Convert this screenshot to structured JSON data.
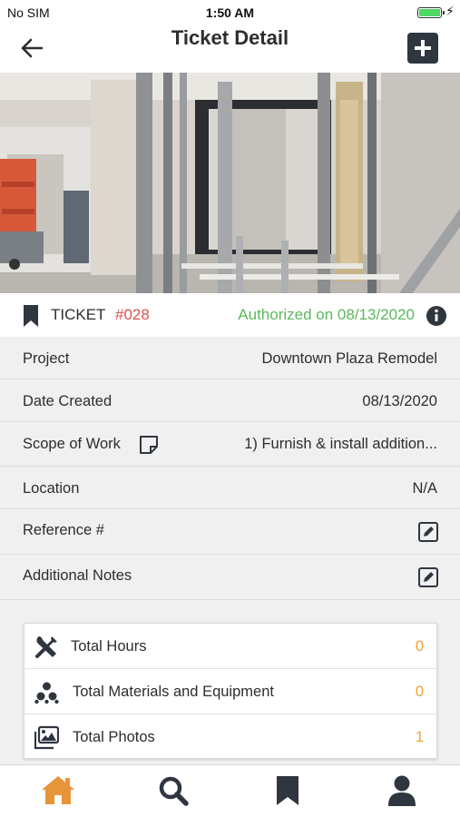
{
  "status_bar": {
    "carrier": "No SIM",
    "time": "1:50 AM"
  },
  "nav": {
    "title": "Ticket Detail",
    "back_icon": "arrow-left-icon",
    "add_icon": "plus-square-icon"
  },
  "ticket": {
    "label": "TICKET",
    "number": "#028",
    "status": "Authorized on 08/13/2020",
    "status_color": "#5cb85c",
    "number_color": "#d9534f"
  },
  "details": {
    "project_label": "Project",
    "project_value": "Downtown Plaza Remodel",
    "date_label": "Date Created",
    "date_value": "08/13/2020",
    "scope_label": "Scope of Work",
    "scope_value": "1) Furnish & install addition...",
    "location_label": "Location",
    "location_value": "N/A",
    "reference_label": "Reference #",
    "notes_label": "Additional Notes"
  },
  "summary": {
    "value_color": "#f0a030",
    "items": [
      {
        "label": "Total Hours",
        "value": "0",
        "icon": "tools-icon"
      },
      {
        "label": "Total Materials and Equipment",
        "value": "0",
        "icon": "cubes-icon"
      },
      {
        "label": "Total Photos",
        "value": "1",
        "icon": "images-icon"
      }
    ]
  },
  "tabs": {
    "active_color": "#e8953a",
    "items": [
      {
        "icon": "home-icon",
        "active": true
      },
      {
        "icon": "search-icon",
        "active": false
      },
      {
        "icon": "bookmark-icon",
        "active": false
      },
      {
        "icon": "user-icon",
        "active": false
      }
    ]
  }
}
